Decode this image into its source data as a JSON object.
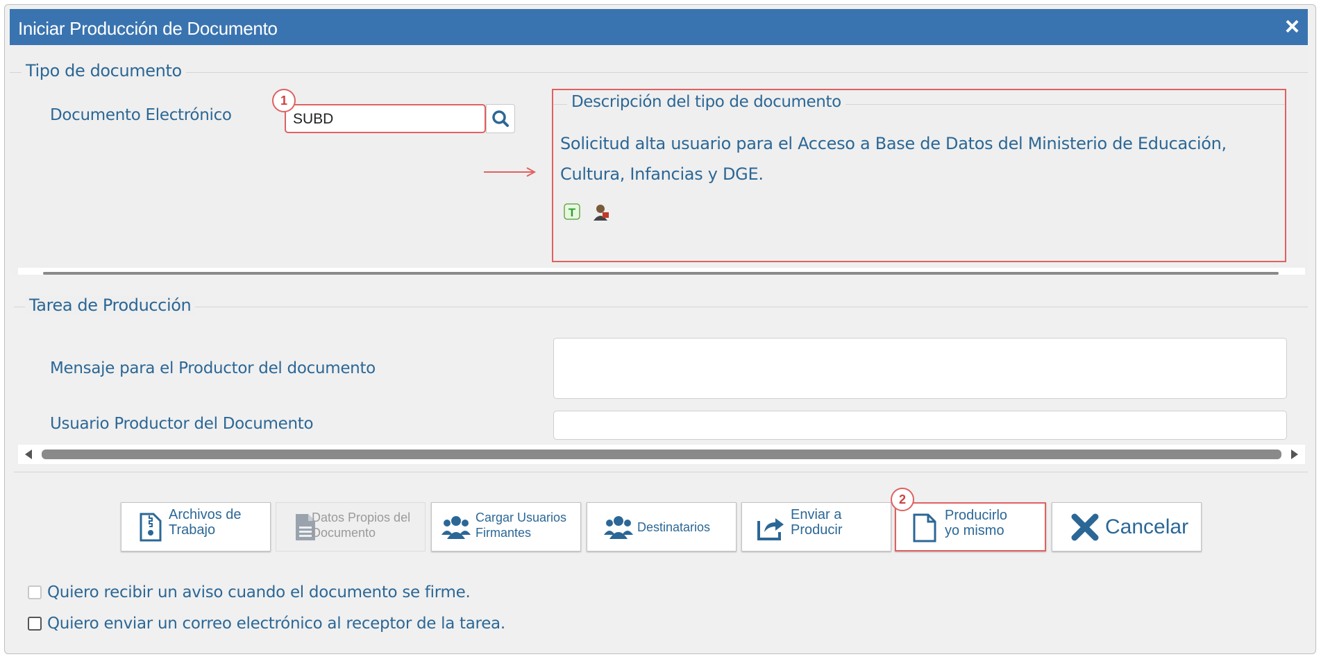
{
  "dialog": {
    "title": "Iniciar Producción de Documento",
    "close_icon": "×"
  },
  "tipo": {
    "legend": "Tipo de documento",
    "doc_label": "Documento Electrónico",
    "doc_value": "SUBD",
    "badge1": "1",
    "desc_legend": "Descripción del tipo de documento",
    "desc_text": "Solicitud alta usuario para el Acceso a Base de Datos del Ministerio de Educación, Cultura, Infancias y DGE."
  },
  "tarea": {
    "legend": "Tarea de Producción",
    "mensaje_label": "Mensaje para el Productor del documento",
    "usuario_label": "Usuario Productor del Documento"
  },
  "buttons": {
    "archivos": "Archivos de\nTrabajo",
    "datos": "Datos Propios del\nDocumento",
    "cargar": "Cargar Usuarios\nFirmantes",
    "destinatarios": "Destinatarios",
    "enviar": "Enviar a\nProducir",
    "producir": "Producirlo\nyo mismo",
    "cancelar": "Cancelar",
    "badge2": "2"
  },
  "checks": {
    "aviso": "Quiero recibir un aviso cuando el documento se firme.",
    "correo": "Quiero enviar un correo electrónico al receptor de la tarea."
  },
  "colors": {
    "titlebar": "#3a74b0",
    "label": "#2b6796",
    "highlight": "#e06060"
  }
}
